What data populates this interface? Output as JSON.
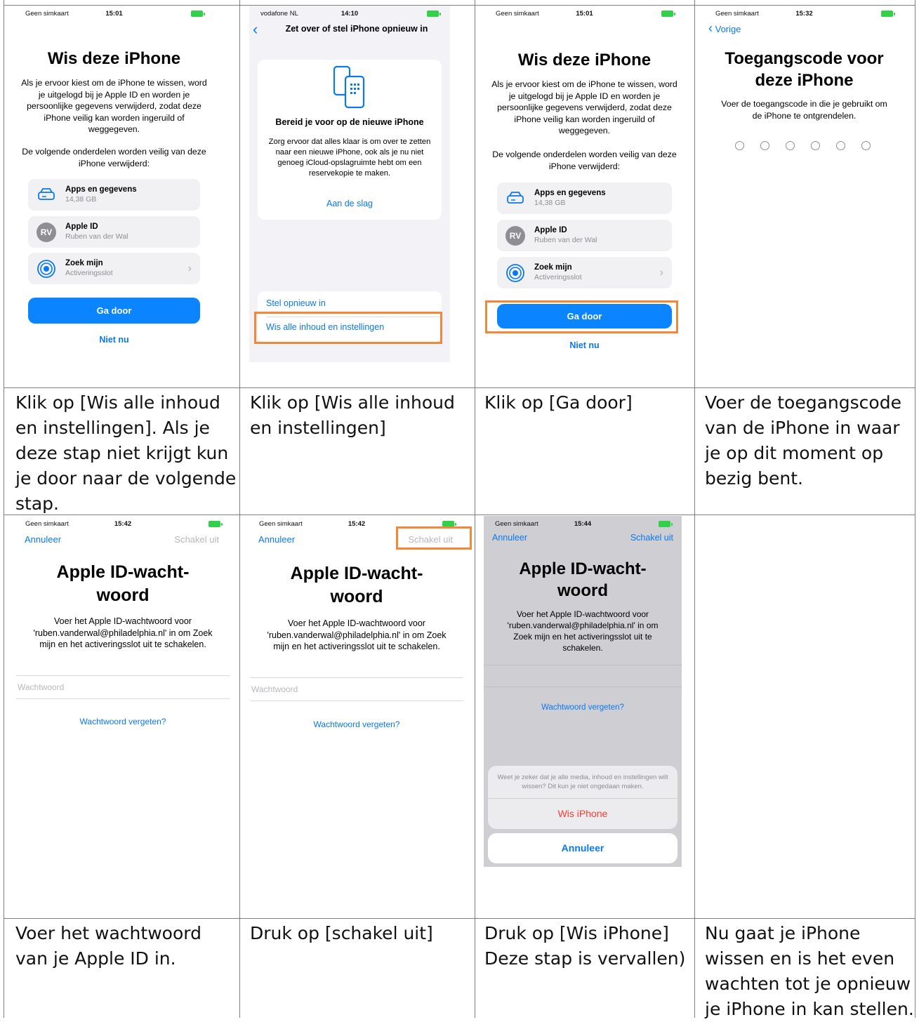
{
  "steps": [
    {
      "caption": "Klik op [Wis alle inhoud\nen instellingen]. Als je\ndeze stap niet krijgt kun\nje door naar de volgende\nstap.",
      "screen": {
        "carrier": "Geen simkaart",
        "time": "15:01",
        "title": "Wis deze iPhone",
        "text": "Als je ervoor kiest om de iPhone te wissen, word je uitgelogd bij je Apple ID en worden je persoonlijke gegevens verwijderd, zodat deze iPhone veilig kan worden ingeruild of weggegeven.",
        "subtext": "De volgende onderdelen worden veilig van deze iPhone verwijderd:",
        "items": [
          {
            "title": "Apps en gegevens",
            "subtitle": "14,38 GB",
            "icon": "drive-icon"
          },
          {
            "title": "Apple ID",
            "subtitle": "Ruben van der Wal",
            "icon": "avatar-icon",
            "initials": "RV"
          },
          {
            "title": "Zoek mijn",
            "subtitle": "Activeringsslot",
            "icon": "findmy-icon"
          }
        ],
        "primary_button": "Ga door",
        "secondary_link": "Niet nu"
      }
    },
    {
      "caption": "Klik op [Wis alle inhoud\nen instellingen]",
      "screen": {
        "carrier": "vodafone NL",
        "time": "14:10",
        "nav_title": "Zet over of stel iPhone opnieuw in",
        "card_title": "Bereid je voor op de nieuwe iPhone",
        "card_text": "Zorg ervoor dat alles klaar is om over te zetten naar een nieuwe iPhone, ook als je nu niet genoeg iCloud-opslagruimte hebt om een reservekopie te maken.",
        "card_link": "Aan de slag",
        "option_reset": "Stel opnieuw in",
        "option_erase": "Wis alle inhoud en instellingen"
      }
    },
    {
      "caption": "Klik op [Ga door]",
      "screen": {
        "carrier": "Geen simkaart",
        "time": "15:01",
        "title": "Wis deze iPhone",
        "text": "Als je ervoor kiest om de iPhone te wissen, word je uitgelogd bij je Apple ID en worden je persoonlijke gegevens verwijderd, zodat deze iPhone veilig kan worden ingeruild of weggegeven.",
        "subtext": "De volgende onderdelen worden veilig van deze iPhone verwijderd:",
        "items": [
          {
            "title": "Apps en gegevens",
            "subtitle": "14,38 GB",
            "icon": "drive-icon"
          },
          {
            "title": "Apple ID",
            "subtitle": "Ruben van der Wal",
            "icon": "avatar-icon",
            "initials": "RV"
          },
          {
            "title": "Zoek mijn",
            "subtitle": "Activeringsslot",
            "icon": "findmy-icon"
          }
        ],
        "primary_button": "Ga door",
        "secondary_link": "Niet nu"
      }
    },
    {
      "caption": "Voer de toegangscode\nvan de iPhone in waar\nje op dit moment op\nbezig bent.",
      "screen": {
        "carrier": "Geen simkaart",
        "time": "15:32",
        "back": "Vorige",
        "title": "Toegangscode voor deze iPhone",
        "text": "Voer de toegangscode in die je gebruikt om de iPhone te ontgrendelen."
      }
    },
    {
      "caption": "Voer het wachtwoord\nvan je Apple ID in.",
      "screen": {
        "carrier": "Geen simkaart",
        "time": "15:42",
        "cancel": "Annuleer",
        "disable": "Schakel uit",
        "title": "Apple ID-wacht-\nwoord",
        "text": "Voer het Apple ID-wachtwoord voor 'ruben.vanderwal@philadelphia.nl' in om Zoek mijn en het activeringsslot uit te schakelen.",
        "placeholder": "Wachtwoord",
        "forgot": "Wachtwoord vergeten?"
      }
    },
    {
      "caption": "Druk op [schakel uit]",
      "screen": {
        "carrier": "Geen simkaart",
        "time": "15:42",
        "cancel": "Annuleer",
        "disable": "Schakel uit",
        "title": "Apple ID-wacht-\nwoord",
        "text": "Voer het Apple ID-wachtwoord voor 'ruben.vanderwal@philadelphia.nl' in om Zoek mijn en het activeringsslot uit te schakelen.",
        "placeholder": "Wachtwoord",
        "forgot": "Wachtwoord vergeten?"
      }
    },
    {
      "caption": "Druk op [Wis iPhone]\nDeze stap is vervallen)",
      "screen": {
        "carrier": "Geen simkaart",
        "time": "15:44",
        "cancel": "Annuleer",
        "disable": "Schakel uit",
        "title": "Apple ID-wacht-\nwoord",
        "text": "Voer het Apple ID-wachtwoord voor 'ruben.vanderwal@philadelphia.nl' in om Zoek mijn en het activeringsslot uit te schakelen.",
        "forgot": "Wachtwoord vergeten?",
        "sheet_text": "Weet je zeker dat je alle media, inhoud en instellingen wilt wissen? Dit kun je niet ongedaan maken.",
        "sheet_destructive": "Wis iPhone",
        "sheet_cancel": "Annuleer"
      }
    },
    {
      "caption": "Nu gaat je iPhone\nwissen en is het even\nwachten tot je opnieuw\nje iPhone in kan stellen."
    }
  ],
  "colors": {
    "accent": "#0a84ff",
    "highlight": "#f0893a",
    "destructive": "#ff3b30",
    "battery": "#33d04a"
  }
}
